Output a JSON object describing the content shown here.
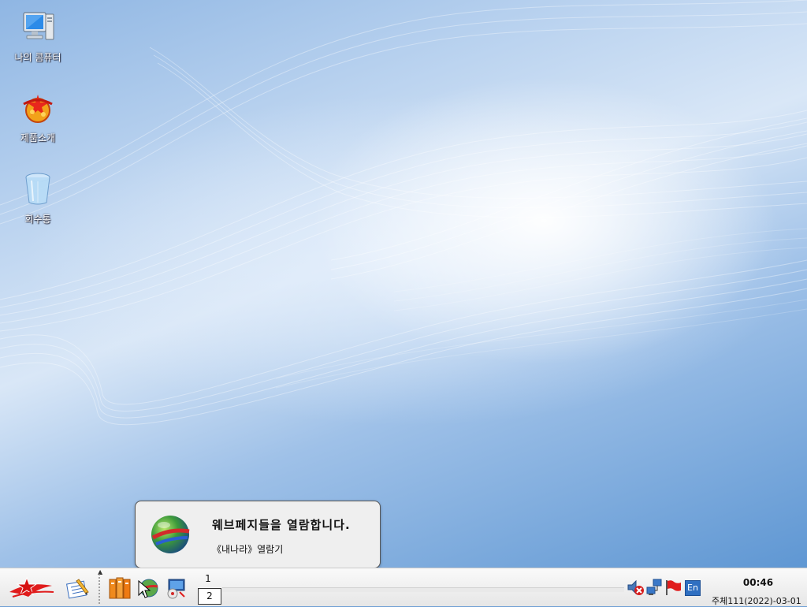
{
  "desktop": {
    "icons": [
      {
        "label": "나의 콤퓨터",
        "icon": "computer-icon"
      },
      {
        "label": "제품소개",
        "icon": "product-intro-icon"
      },
      {
        "label": "회수통",
        "icon": "recycle-bin-icon"
      }
    ]
  },
  "notification": {
    "title": "웨브페지들을 열람합니다.",
    "body": "《내나라》열람기",
    "icon": "browser-globe-icon"
  },
  "taskbar": {
    "start_icon": "red-star-start-icon",
    "launchers": [
      "notes-icon",
      "file-manager-icon",
      "browser-icon",
      "network-tool-icon"
    ],
    "workspaces": [
      "1",
      "2"
    ],
    "active_workspace": "2",
    "tray": {
      "volume_icon": "volume-muted-icon",
      "network_icon": "network-icon",
      "flag_icon": "red-flag-icon",
      "language": "En"
    },
    "clock": {
      "time": "00:46",
      "date": "주체111(2022)-03-01"
    }
  },
  "colors": {
    "desktop_blue": "#6f9fd4",
    "taskbar_bg": "#f0f0f0",
    "accent_red": "#e02020"
  }
}
